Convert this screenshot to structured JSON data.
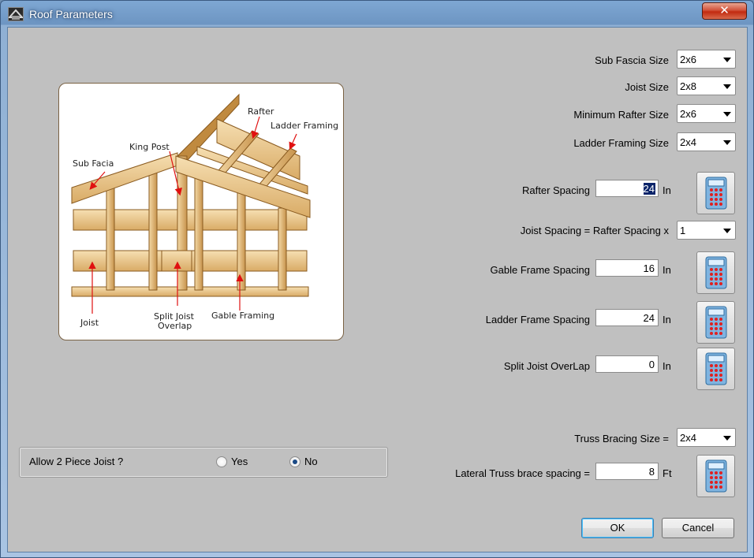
{
  "window": {
    "title": "Roof Parameters",
    "close_glyph": "✕"
  },
  "diagram": {
    "labels": {
      "rafter": "Rafter",
      "ladder_framing": "Ladder Framing",
      "king_post": "King Post",
      "sub_facia": "Sub Facia",
      "joist": "Joist",
      "split_joist_overlap_1": "Split Joist",
      "split_joist_overlap_2": "Overlap",
      "gable_framing": "Gable Framing"
    },
    "wood_color": "#e9c98f",
    "arrow_color": "#e01010"
  },
  "fields": {
    "sub_fascia_size": {
      "label": "Sub Fascia Size",
      "value": "2x6"
    },
    "joist_size": {
      "label": "Joist Size",
      "value": "2x8"
    },
    "min_rafter_size": {
      "label": "Minimum Rafter Size",
      "value": "2x6"
    },
    "ladder_framing_size": {
      "label": "Ladder Framing Size",
      "value": "2x4"
    },
    "rafter_spacing": {
      "label": "Rafter Spacing",
      "value": "24",
      "unit": "In"
    },
    "joist_spacing": {
      "label": "Joist Spacing = Rafter Spacing x",
      "value": "1"
    },
    "gable_frame_spacing": {
      "label": "Gable Frame Spacing",
      "value": "16",
      "unit": "In"
    },
    "ladder_frame_spacing": {
      "label": "Ladder Frame Spacing",
      "value": "24",
      "unit": "In"
    },
    "split_joist_overlap": {
      "label": "Split Joist OverLap",
      "value": "0",
      "unit": "In"
    },
    "truss_bracing_size": {
      "label": "Truss Bracing Size =",
      "value": "2x4"
    },
    "lateral_truss_brace_spacing": {
      "label": "Lateral Truss brace spacing =",
      "value": "8",
      "unit": "Ft"
    }
  },
  "allow_two_piece_joist": {
    "question": "Allow 2 Piece Joist ?",
    "yes_label": "Yes",
    "no_label": "No",
    "selected": "No"
  },
  "buttons": {
    "ok": "OK",
    "cancel": "Cancel"
  },
  "icons": {
    "app": "roof-app-icon",
    "close": "close-icon",
    "calculator": "calculator-icon",
    "dropdown": "chevron-down-icon"
  }
}
